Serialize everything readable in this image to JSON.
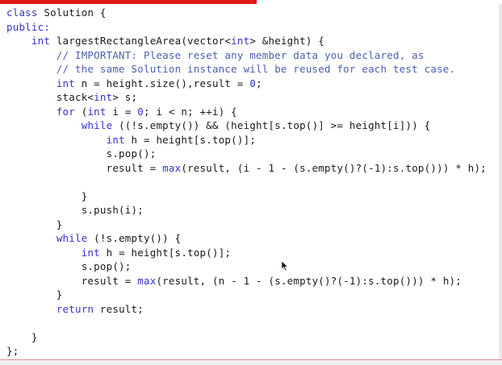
{
  "code_lines": [
    [
      {
        "t": "class",
        "k": "kw"
      },
      {
        "t": " Solution {",
        "k": ""
      }
    ],
    [
      {
        "t": "public:",
        "k": "kw"
      }
    ],
    [
      {
        "t": "    ",
        "k": ""
      },
      {
        "t": "int",
        "k": "kw"
      },
      {
        "t": " largestRectangleArea(vector<",
        "k": ""
      },
      {
        "t": "int",
        "k": "kw"
      },
      {
        "t": "> &height) {",
        "k": ""
      }
    ],
    [
      {
        "t": "        // IMPORTANT: Please reset any member data you declared, as",
        "k": "cm"
      }
    ],
    [
      {
        "t": "        // the same Solution instance will be reused for each test case.",
        "k": "cm"
      }
    ],
    [
      {
        "t": "        ",
        "k": ""
      },
      {
        "t": "int",
        "k": "kw"
      },
      {
        "t": " n = height.size(),result = ",
        "k": ""
      },
      {
        "t": "0",
        "k": "kw"
      },
      {
        "t": ";",
        "k": ""
      }
    ],
    [
      {
        "t": "        stack<",
        "k": ""
      },
      {
        "t": "int",
        "k": "kw"
      },
      {
        "t": "> s;",
        "k": ""
      }
    ],
    [
      {
        "t": "        ",
        "k": ""
      },
      {
        "t": "for",
        "k": "kw"
      },
      {
        "t": " (",
        "k": ""
      },
      {
        "t": "int",
        "k": "kw"
      },
      {
        "t": " i = ",
        "k": ""
      },
      {
        "t": "0",
        "k": "kw"
      },
      {
        "t": "; i < n; ++i) {",
        "k": ""
      }
    ],
    [
      {
        "t": "            ",
        "k": ""
      },
      {
        "t": "while",
        "k": "kw"
      },
      {
        "t": " ((!s.empty()) && (height[s.top()] >= height[i])) {",
        "k": ""
      }
    ],
    [
      {
        "t": "                ",
        "k": ""
      },
      {
        "t": "int",
        "k": "kw"
      },
      {
        "t": " h = height[s.top()];",
        "k": ""
      }
    ],
    [
      {
        "t": "                s.pop();",
        "k": ""
      }
    ],
    [
      {
        "t": "                result = ",
        "k": ""
      },
      {
        "t": "max",
        "k": "kw"
      },
      {
        "t": "(result, (i - 1 - (s.empty()?(-1):s.top())) * h);",
        "k": ""
      }
    ],
    [],
    [
      {
        "t": "            }",
        "k": ""
      }
    ],
    [
      {
        "t": "            s.push(i);",
        "k": ""
      }
    ],
    [
      {
        "t": "        }",
        "k": ""
      }
    ],
    [
      {
        "t": "        ",
        "k": ""
      },
      {
        "t": "while",
        "k": "kw"
      },
      {
        "t": " (!s.empty()) {",
        "k": ""
      }
    ],
    [
      {
        "t": "            ",
        "k": ""
      },
      {
        "t": "int",
        "k": "kw"
      },
      {
        "t": " h = height[s.top()];",
        "k": ""
      }
    ],
    [
      {
        "t": "            s.pop();",
        "k": ""
      }
    ],
    [
      {
        "t": "            result = ",
        "k": ""
      },
      {
        "t": "max",
        "k": "kw"
      },
      {
        "t": "(result, (n - 1 - (s.empty()?(-1):s.top())) * h);",
        "k": ""
      }
    ],
    [
      {
        "t": "        }",
        "k": ""
      }
    ],
    [
      {
        "t": "        ",
        "k": ""
      },
      {
        "t": "return",
        "k": "kw"
      },
      {
        "t": " result;",
        "k": ""
      }
    ],
    [],
    [
      {
        "t": "    }",
        "k": ""
      }
    ],
    [
      {
        "t": "};",
        "k": ""
      }
    ]
  ],
  "colors": {
    "keyword": "#3333cc",
    "comment": "#4a5fb0",
    "text": "#1a1a1a",
    "accent_bar": "#e01818"
  }
}
